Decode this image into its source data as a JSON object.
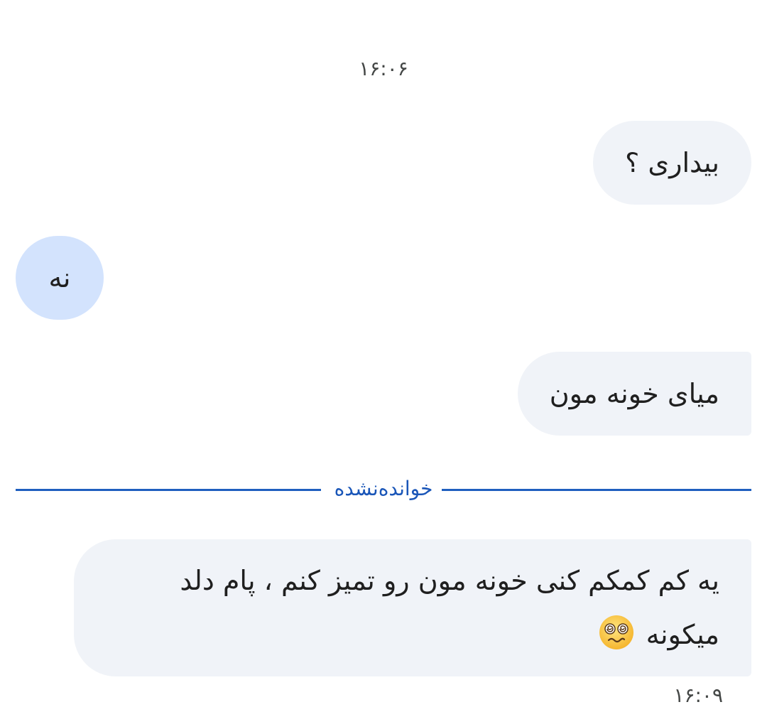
{
  "conversation": {
    "time_header": "۱۶:۰۶",
    "messages": [
      {
        "direction": "incoming",
        "text": "بیداری ؟"
      },
      {
        "direction": "outgoing",
        "text": "نه"
      },
      {
        "direction": "incoming",
        "text": "میای خونه مون"
      },
      {
        "direction": "incoming",
        "text": "یه کم کمکم کنی خونه مون رو تمیز کنم ، پام دلد میکونه",
        "emoji": "woozy-face-emoji"
      }
    ],
    "unread_divider": "خواندەنشده",
    "time_footer": "۱۶:۰۹"
  },
  "colors": {
    "incoming_bubble": "#f0f3f8",
    "outgoing_bubble": "#d3e3fd",
    "unread_accent": "#1a56b8"
  }
}
